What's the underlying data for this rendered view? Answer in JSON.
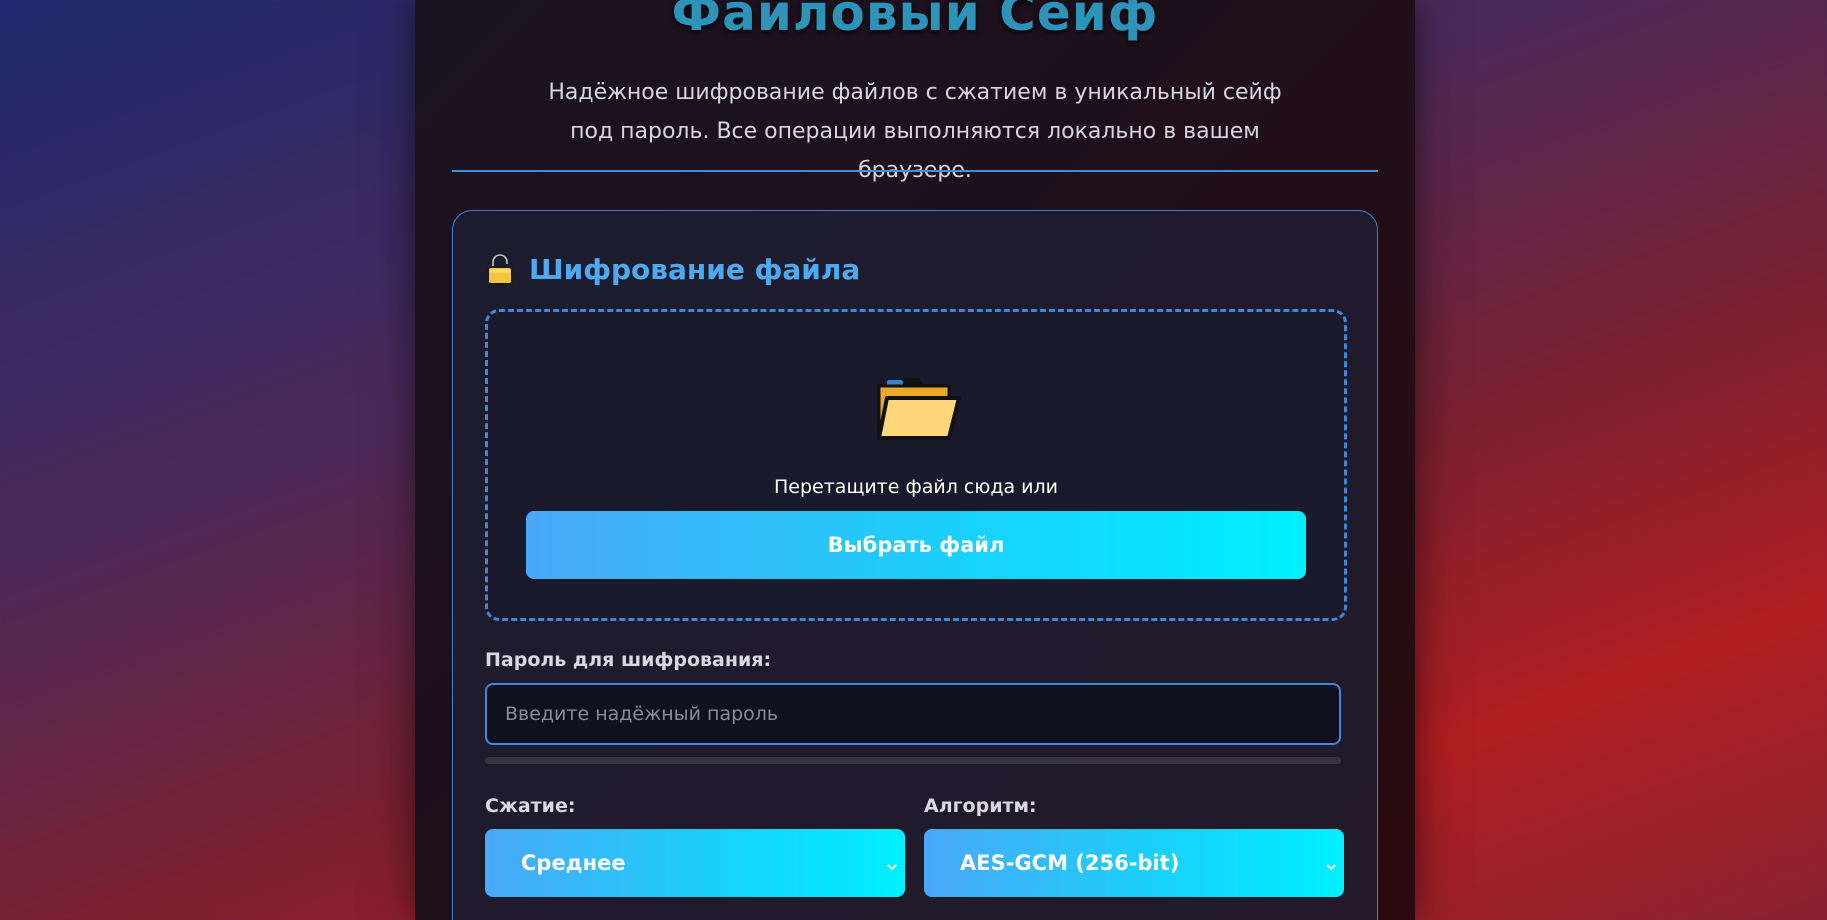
{
  "header": {
    "title": "Файловый Сейф",
    "subtitle": "Надёжное шифрование файлов с сжатием в уникальный сейф под пароль. Все операции выполняются локально в вашем браузере."
  },
  "encrypt_card": {
    "title": "Шифрование файла",
    "icon": "lock-icon",
    "dropzone": {
      "icon": "folder-icon",
      "text": "Перетащите файл сюда или",
      "button_label": "Выбрать файл"
    },
    "password": {
      "label": "Пароль для шифрования:",
      "value": "",
      "placeholder": "Введите надёжный пароль",
      "strength": 0
    },
    "compression": {
      "label": "Сжатие:",
      "selected": "Среднее"
    },
    "algorithm": {
      "label": "Алгоритм:",
      "selected": "AES-GCM (256-bit)"
    }
  },
  "colors": {
    "accent": "#3f8ae0",
    "title": "#2d93b8",
    "card_title": "#4eaaf0",
    "button_gradient_start": "#4aa8f8",
    "button_gradient_end": "#00f0ff"
  }
}
